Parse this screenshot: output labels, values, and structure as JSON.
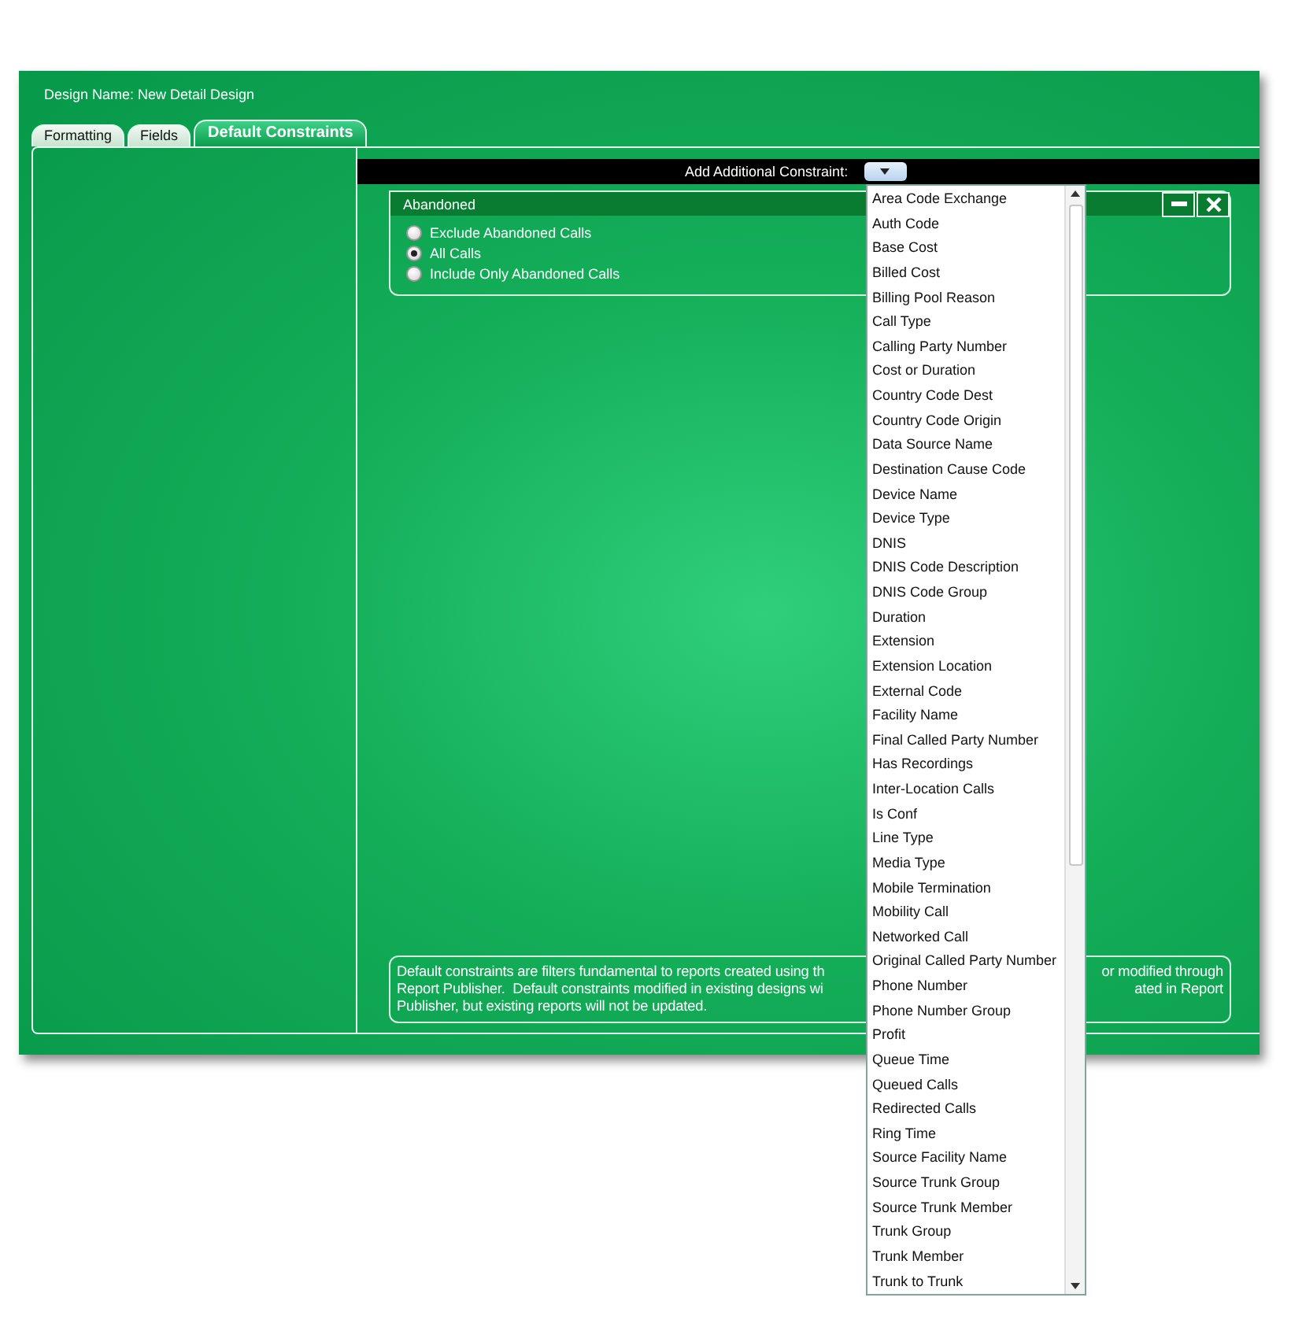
{
  "design_name": "Design Name: New Detail Design",
  "tabs": [
    {
      "label": "Formatting",
      "selected": false
    },
    {
      "label": "Fields",
      "selected": false
    },
    {
      "label": "Default Constraints",
      "selected": true
    }
  ],
  "constraint_bar": {
    "label": "Add Additional Constraint:"
  },
  "constraint_panel": {
    "title": "Abandoned",
    "options": [
      {
        "label": "Exclude Abandoned Calls",
        "selected": false
      },
      {
        "label": "All Calls",
        "selected": true
      },
      {
        "label": "Include Only Abandoned Calls",
        "selected": false
      }
    ]
  },
  "note": {
    "left_lines": [
      "Default constraints are filters fundamental to reports created using th",
      "Report Publisher.  Default constraints modified in existing designs wi",
      "Publisher, but existing reports will not be updated."
    ],
    "right_lines": [
      "or modified through",
      "ated in Report"
    ]
  },
  "dropdown": {
    "items": [
      "Area Code Exchange",
      "Auth Code",
      "Base Cost",
      "Billed Cost",
      "Billing Pool Reason",
      "Call Type",
      "Calling Party Number",
      "Cost or Duration",
      "Country Code Dest",
      "Country Code Origin",
      "Data Source Name",
      "Destination Cause Code",
      "Device Name",
      "Device Type",
      "DNIS",
      "DNIS Code Description",
      "DNIS Code Group",
      "Duration",
      "Extension",
      "Extension Location",
      "External Code",
      "Facility Name",
      "Final Called Party Number",
      "Has Recordings",
      "Inter-Location Calls",
      "Is Conf",
      "Line Type",
      "Media Type",
      "Mobile Termination",
      "Mobility Call",
      "Networked Call",
      "Original Called Party Number",
      "Phone Number",
      "Phone Number Group",
      "Profit",
      "Queue Time",
      "Queued Calls",
      "Redirected Calls",
      "Ring Time",
      "Source Facility Name",
      "Source Trunk Group",
      "Source Trunk Member",
      "Trunk Group",
      "Trunk Member",
      "Trunk to Trunk"
    ]
  }
}
